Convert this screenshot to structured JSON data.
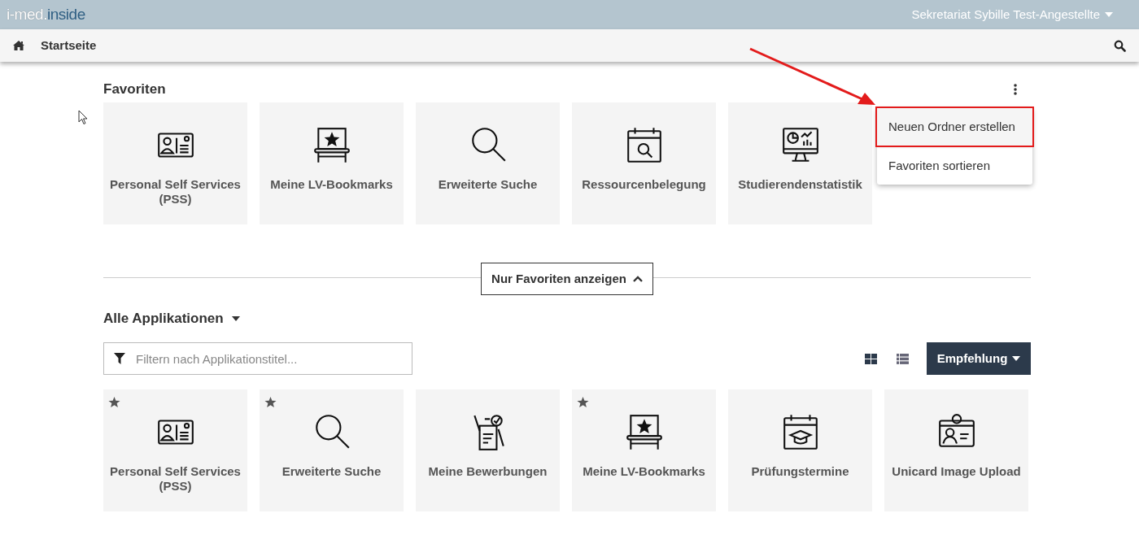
{
  "header": {
    "logo_part_1": "i-med.",
    "logo_part_2": "inside",
    "user_menu": "Sekretariat Sybille Test-Angestellte"
  },
  "nav": {
    "home_label": "Startseite"
  },
  "favorites": {
    "title": "Favoriten",
    "tiles": [
      {
        "kind": "id-card",
        "label": "Personal Self Services (PSS)"
      },
      {
        "kind": "bookmark",
        "label": "Meine LV-Bookmarks"
      },
      {
        "kind": "search",
        "label": "Erweiterte Suche"
      },
      {
        "kind": "calendar-search",
        "label": "Ressourcenbelegung"
      },
      {
        "kind": "monitor-chart",
        "label": "Studierendenstatistik"
      }
    ],
    "menu": [
      {
        "label": "Neuen Ordner erstellen",
        "highlighted": true
      },
      {
        "label": "Favoriten sortieren",
        "highlighted": false
      }
    ]
  },
  "toggle_button": "Nur Favoriten anzeigen",
  "applications": {
    "title": "Alle Applikationen",
    "filter": {
      "placeholder": "Filtern nach Applikationstitel..."
    },
    "views": [
      {
        "kind": "grid",
        "selected": true
      },
      {
        "kind": "list",
        "selected": false
      }
    ],
    "sort_button": "Empfehlung",
    "tiles": [
      {
        "kind": "id-card",
        "label": "Personal Self Services (PSS)",
        "favorite": true
      },
      {
        "kind": "search",
        "label": "Erweiterte Suche",
        "favorite": true
      },
      {
        "kind": "applications",
        "label": "Meine Bewerbungen",
        "favorite": false
      },
      {
        "kind": "bookmark",
        "label": "Meine LV-Bookmarks",
        "favorite": true
      },
      {
        "kind": "calendar-cap",
        "label": "Prüfungstermine",
        "favorite": false
      },
      {
        "kind": "badge",
        "label": "Unicard Image Upload",
        "favorite": false
      }
    ]
  }
}
